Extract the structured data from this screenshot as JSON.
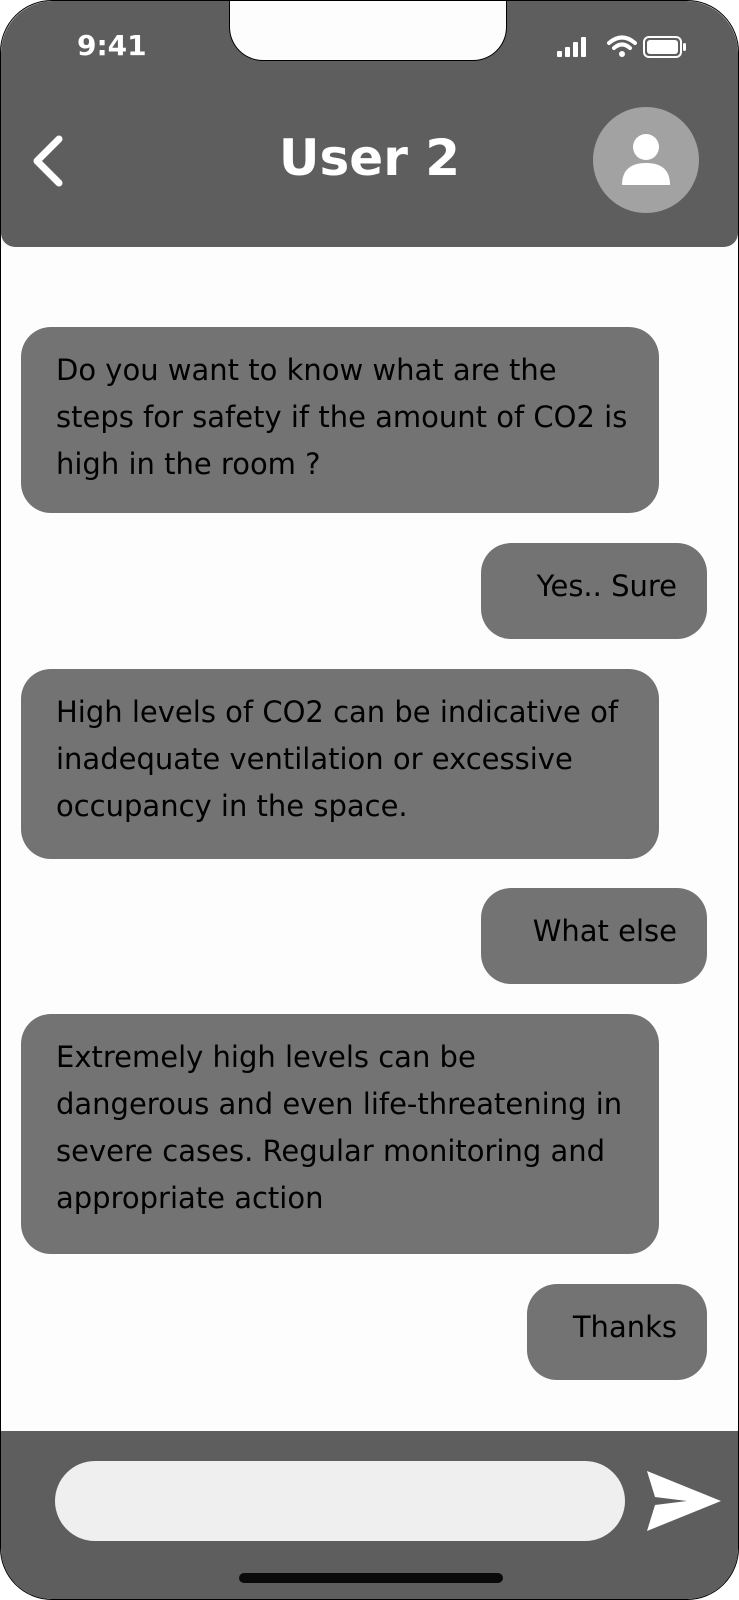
{
  "status_bar": {
    "time": "9:41"
  },
  "header": {
    "title": "User 2"
  },
  "messages": [
    {
      "side": "in",
      "text": "Do you want to know what are the steps for safety if the amount of CO2 is high in the room ?"
    },
    {
      "side": "out",
      "text": "Yes.. Sure"
    },
    {
      "side": "in",
      "text": "High levels of CO2 can be indicative of inadequate ventilation or excessive occupancy in the space."
    },
    {
      "side": "out",
      "text": "What else"
    },
    {
      "side": "in",
      "text": "Extremely high levels can be dangerous and even life-threatening in severe cases. Regular monitoring and appropriate action"
    },
    {
      "side": "out",
      "text": "Thanks"
    }
  ],
  "composer": {
    "value": ""
  },
  "icons": {
    "back": "chevron-left-icon",
    "avatar": "user-icon",
    "send": "send-icon",
    "signal": "signal-icon",
    "wifi": "wifi-icon",
    "battery": "battery-icon"
  },
  "colors": {
    "header": "#5e5e5e",
    "bubble": "#737373",
    "avatar": "#a2a2a2",
    "input": "#efefef"
  }
}
